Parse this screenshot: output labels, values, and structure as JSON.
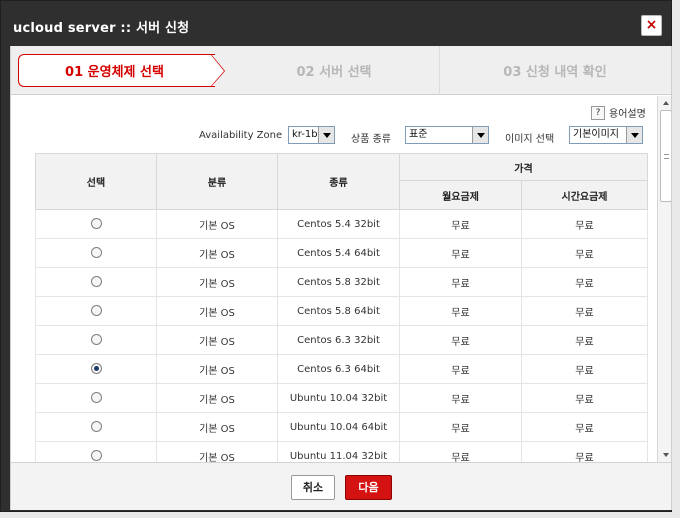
{
  "window": {
    "title": "ucloud server :: 서버 신청",
    "close_label": "×"
  },
  "steps": [
    {
      "label": "01 운영체제 선택"
    },
    {
      "label": "02 서버 선택"
    },
    {
      "label": "03 신청 내역 확인"
    }
  ],
  "help": {
    "label": "용어설명",
    "icon": "?"
  },
  "filters": {
    "zone_label": "Availability Zone",
    "zone_value": "kr-1b",
    "product_label": "상품 종류",
    "product_value": "표준",
    "image_label": "이미지 선택",
    "image_value": "기본이미지"
  },
  "table": {
    "headers": {
      "select": "선택",
      "category": "분류",
      "type": "종류",
      "price": "가격",
      "monthly": "월요금제",
      "hourly": "시간요금제"
    },
    "rows": [
      {
        "category": "기본 OS",
        "type": "Centos 5.4 32bit",
        "monthly": "무료",
        "hourly": "무료",
        "selected": false
      },
      {
        "category": "기본 OS",
        "type": "Centos 5.4 64bit",
        "monthly": "무료",
        "hourly": "무료",
        "selected": false
      },
      {
        "category": "기본 OS",
        "type": "Centos 5.8 32bit",
        "monthly": "무료",
        "hourly": "무료",
        "selected": false
      },
      {
        "category": "기본 OS",
        "type": "Centos 5.8 64bit",
        "monthly": "무료",
        "hourly": "무료",
        "selected": false
      },
      {
        "category": "기본 OS",
        "type": "Centos 6.3 32bit",
        "monthly": "무료",
        "hourly": "무료",
        "selected": false
      },
      {
        "category": "기본 OS",
        "type": "Centos 6.3 64bit",
        "monthly": "무료",
        "hourly": "무료",
        "selected": true
      },
      {
        "category": "기본 OS",
        "type": "Ubuntu 10.04 32bit",
        "monthly": "무료",
        "hourly": "무료",
        "selected": false
      },
      {
        "category": "기본 OS",
        "type": "Ubuntu 10.04 64bit",
        "monthly": "무료",
        "hourly": "무료",
        "selected": false
      },
      {
        "category": "기본 OS",
        "type": "Ubuntu 11.04 32bit",
        "monthly": "무료",
        "hourly": "무료",
        "selected": false
      }
    ]
  },
  "footer": {
    "cancel_label": "취소",
    "next_label": "다음"
  }
}
